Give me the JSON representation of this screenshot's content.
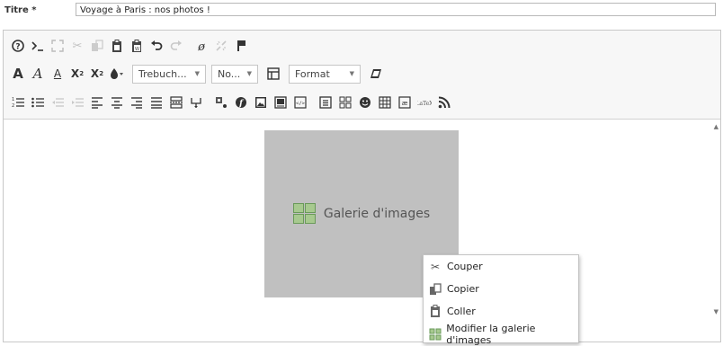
{
  "title_field": {
    "label": "Titre *",
    "value": "Voyage à Paris : nos photos !"
  },
  "toolbar": {
    "row1": [
      "help-icon",
      "source-icon",
      "maximize-icon",
      "cut-icon",
      "copy-icon",
      "paste-icon",
      "paste-text-icon",
      "undo-icon",
      "redo-icon",
      "remove-format-icon",
      "unlink-icon",
      "flag-icon"
    ],
    "font_family": "Trebuch...",
    "font_size": "No...",
    "format": "Format"
  },
  "gallery": {
    "label": "Galerie d'images"
  },
  "context_menu": {
    "items": [
      {
        "label": "Couper",
        "icon": "cut-icon"
      },
      {
        "label": "Copier",
        "icon": "copy-icon"
      },
      {
        "label": "Coller",
        "icon": "paste-icon"
      },
      {
        "label": "Modifier la galerie d'images",
        "icon": "gallery-icon"
      }
    ]
  },
  "colors": {
    "toolbar_bg": "#f7f7f7",
    "gallery_bg": "#c0c0c0",
    "border": "#c8c8c8"
  }
}
